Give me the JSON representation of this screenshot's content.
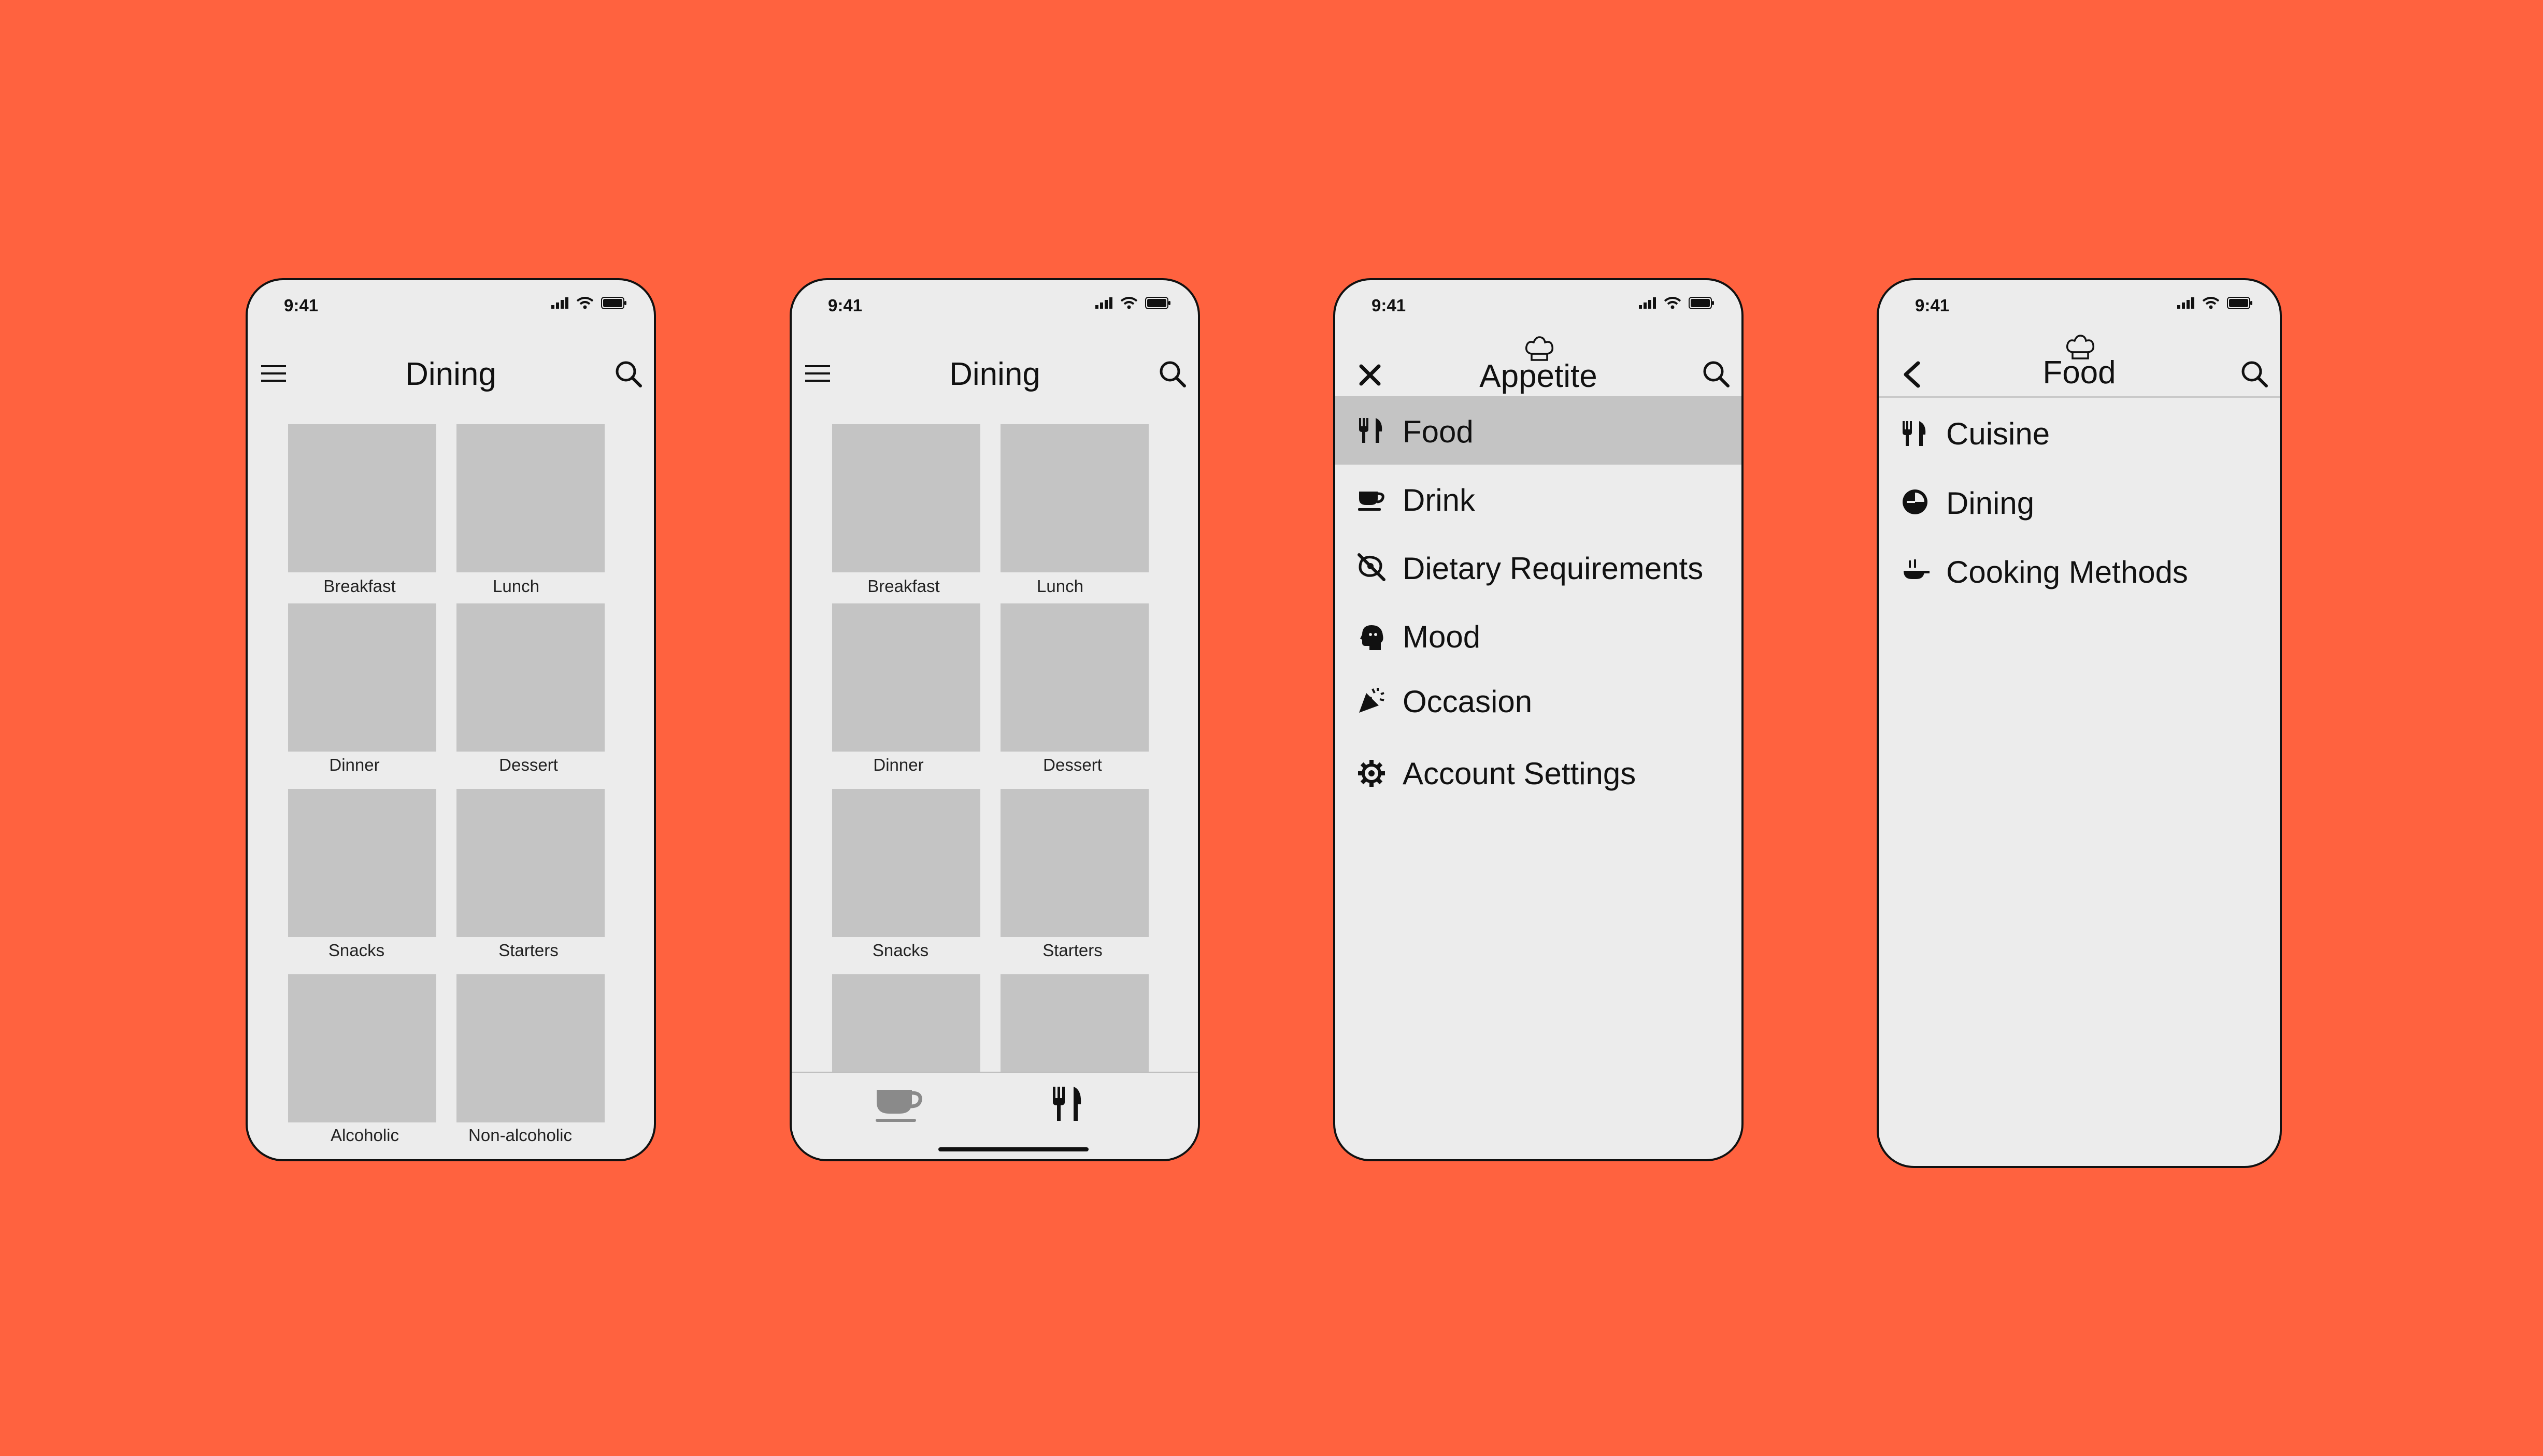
{
  "status_time": "9:41",
  "screen1": {
    "title": "Dining",
    "tiles": [
      "Breakfast",
      "Lunch",
      "Dinner",
      "Dessert",
      "Snacks",
      "Starters",
      "Alcoholic",
      "Non-alcoholic"
    ]
  },
  "screen2": {
    "title": "Dining",
    "tiles": [
      "Breakfast",
      "Lunch",
      "Dinner",
      "Dessert",
      "Snacks",
      "Starters",
      "",
      ""
    ],
    "tabs": [
      "drink-tab",
      "food-tab"
    ]
  },
  "screen3": {
    "title": "Appetite",
    "menu": [
      "Food",
      "Drink",
      "Dietary Requirements",
      "Mood",
      "Occasion",
      "Account Settings"
    ],
    "active_item": "Food"
  },
  "screen4": {
    "title": "Food",
    "menu": [
      "Cuisine",
      "Dining",
      "Cooking Methods"
    ]
  },
  "colors": {
    "background": "#FF623F",
    "screen": "#ECECEC",
    "placeholder": "#C4C4C4",
    "active_row": "#C4C4C4"
  }
}
